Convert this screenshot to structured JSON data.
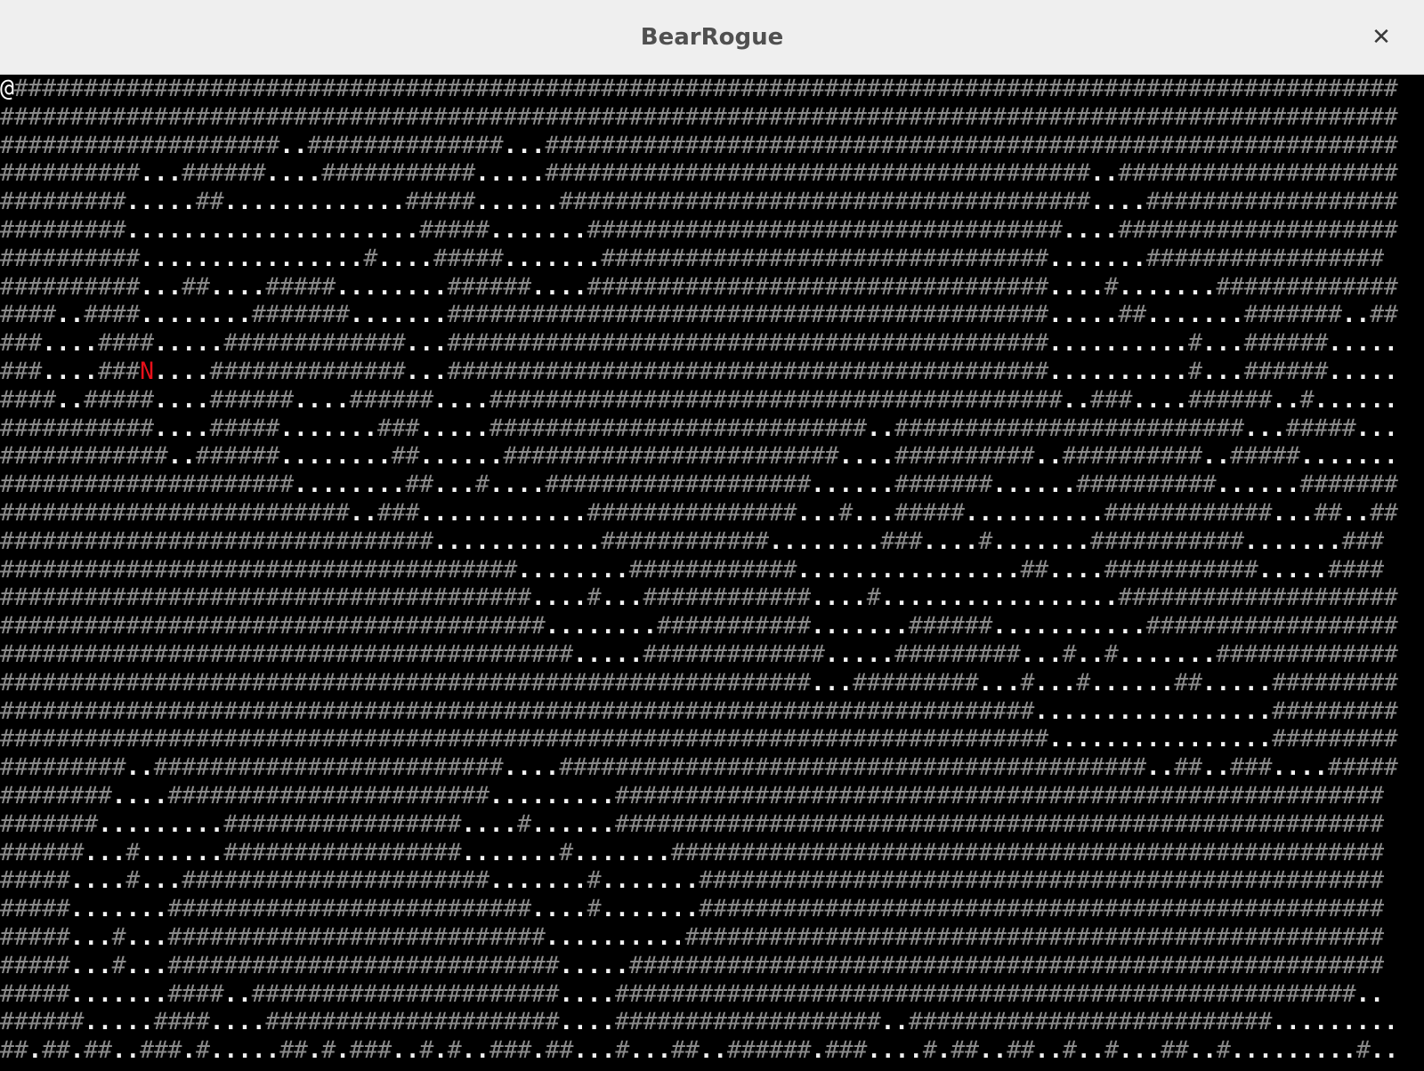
{
  "window": {
    "title": "BearRogue",
    "close_icon": "close-icon"
  },
  "entities": {
    "player": {
      "glyph": "@",
      "row": 0,
      "col": 0
    },
    "monster": {
      "glyph": "N",
      "row": 10,
      "col": 10
    }
  },
  "colors": {
    "wall": "#8a8a8a",
    "floor": "#f2f2f2",
    "player": "#ffffff",
    "monster": "#e8101a",
    "background": "#000000",
    "titlebar": "#efefef"
  },
  "map": [
    "@###################################################################################################",
    "####################################################################################################",
    "####################..##############...#############################################################",
    "##########...######....###########.....#######################################..####################",
    "#########.....##.............#####......######################################....##################",
    "#########.....................#####.......##################################....####################",
    "##########................#....#####.......################################.......#################",
    "##########...##....#####........######....#################################....#.......#############",
    "####..####........#######.......###########################################.....##.......#######..##",
    "###....####.....#############...###########################################..........#...######.....",
    "###....###N....##############...###########################################..........#...######.....",
    "####..#####....######....######....#########################################..###....######..#......",
    "###########....#####.......###.....###########################..#########################...#####...",
    "############..######........##......########################....##########..##########..#####.......",
    "#####################........##...#....###################......#######......##########......#######",
    "#########################..###............###############...#...#####..........############...##..##",
    "###############################............############........###....#.......###########.......###",
    "#####################################........############................##....###########.....####",
    "######################################....#...############....#.................####################",
    "#######################################........###########.......######...........##################",
    "#########################################.....#############.....#########...#..#.......#############",
    "##########################################################...#########...#...#......##.....#########",
    "##########################################################################.................#########",
    "###########################################################################................#########",
    "#########..#########################....##########################################..##..###....#####",
    "########....#######################.........#######################################################",
    "#######.........#################....#......#######################################################",
    "######...#......#################.......#.......###################################################",
    "#####....#...######################.......#.......#################################################",
    "#####.......##########################....#.......#################################################",
    "#####...#...###########################..........##################################################",
    "#####...#...############################.....######################################################",
    "#####.......####..######################....#####################################################..",
    "######.....####....#####################....###################..##########################.........",
    "##.##.##..###.#.....##.#.###..#.#..###.##...#...##..######.###....#.##..##..#..#...##..#.........#.."
  ]
}
